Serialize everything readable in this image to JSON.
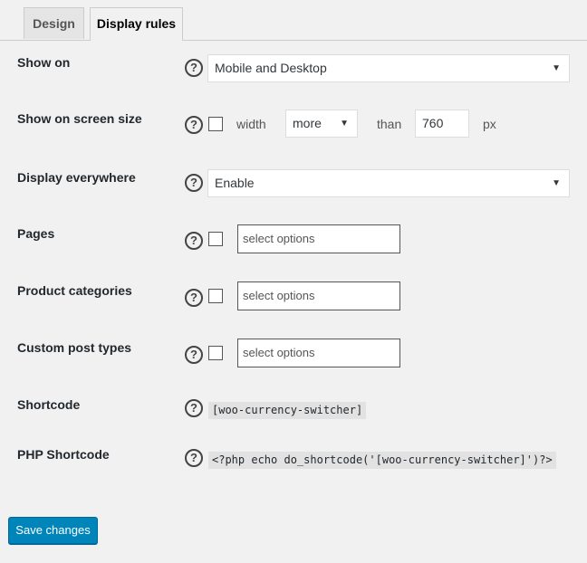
{
  "tabs": [
    {
      "label": "Design",
      "active": false
    },
    {
      "label": "Display rules",
      "active": true
    }
  ],
  "help_glyph": "?",
  "rows": {
    "show_on": {
      "label": "Show on",
      "select_value": "Mobile and Desktop"
    },
    "screen_size": {
      "label": "Show on screen size",
      "checked": false,
      "width_text": "width",
      "comparator": "more",
      "than_text": "than",
      "value": "760",
      "unit": "px"
    },
    "display_everywhere": {
      "label": "Display everywhere",
      "select_value": "Enable"
    },
    "pages": {
      "label": "Pages",
      "checked": false,
      "placeholder": "select options"
    },
    "product_categories": {
      "label": "Product categories",
      "checked": false,
      "placeholder": "select options"
    },
    "custom_post_types": {
      "label": "Custom post types",
      "checked": false,
      "placeholder": "select options"
    },
    "shortcode": {
      "label": "Shortcode",
      "code": "[woo-currency-switcher]"
    },
    "php_shortcode": {
      "label": "PHP Shortcode",
      "code": "<?php echo do_shortcode('[woo-currency-switcher]')?>"
    }
  },
  "dropdown_arrow": "▼",
  "save_label": "Save changes",
  "colors": {
    "accent": "#0085ba",
    "background": "#f1f1f1"
  },
  "icons": {
    "help": "question-circle-icon",
    "dropdown": "chevron-down-icon"
  }
}
